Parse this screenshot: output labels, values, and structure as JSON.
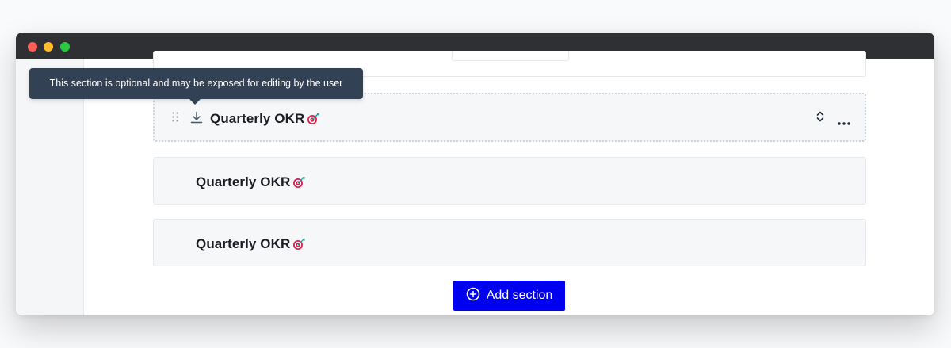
{
  "window": {
    "traffic_lights": [
      "close",
      "minimize",
      "zoom"
    ]
  },
  "tooltip": {
    "text": "This section is optional and may be exposed for editing by the user"
  },
  "sections": [
    {
      "title": "Quarterly OKR",
      "emoji": "dart-target-icon",
      "active": true
    },
    {
      "title": "Quarterly OKR",
      "emoji": "dart-target-icon",
      "active": false
    },
    {
      "title": "Quarterly OKR",
      "emoji": "dart-target-icon",
      "active": false
    }
  ],
  "actions": {
    "add_section_label": "Add section"
  },
  "colors": {
    "titlebar": "#2f3033",
    "primary_button": "#0000f0",
    "tooltip_bg": "#334155",
    "card_bg": "#f6f7f9"
  }
}
